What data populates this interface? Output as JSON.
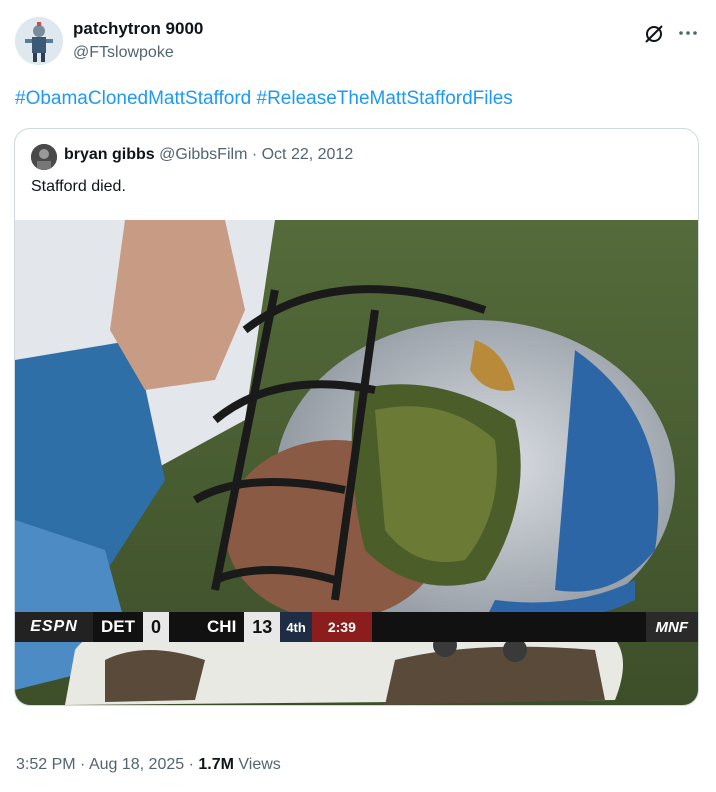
{
  "author": {
    "name": "patchytron 9000",
    "handle": "@FTslowpoke"
  },
  "tweet": {
    "hashtag1": "#ObamaClonedMattStafford",
    "hashtag2": "#ReleaseTheMattStaffordFiles"
  },
  "quote": {
    "name": "bryan gibbs",
    "handle": "@GibbsFilm",
    "separator": " · ",
    "date": "Oct 22, 2012",
    "text": "Stafford died.",
    "scorebug": {
      "network_logo": "ESPN",
      "team1": "DET",
      "score1": "0",
      "team2": "CHI",
      "score2": "13",
      "quarter": "4th",
      "clock": "2:39",
      "broadcast": "MNF"
    }
  },
  "footer": {
    "time": "3:52 PM",
    "dot": " · ",
    "date": "Aug 18, 2025",
    "views_count": "1.7M",
    "views_label": "Views"
  },
  "icons": {
    "grok": "grok-icon",
    "more": "more-icon"
  },
  "colors": {
    "link": "#1d9bf0",
    "secondary_text": "#536471",
    "border": "#cfd9de"
  }
}
